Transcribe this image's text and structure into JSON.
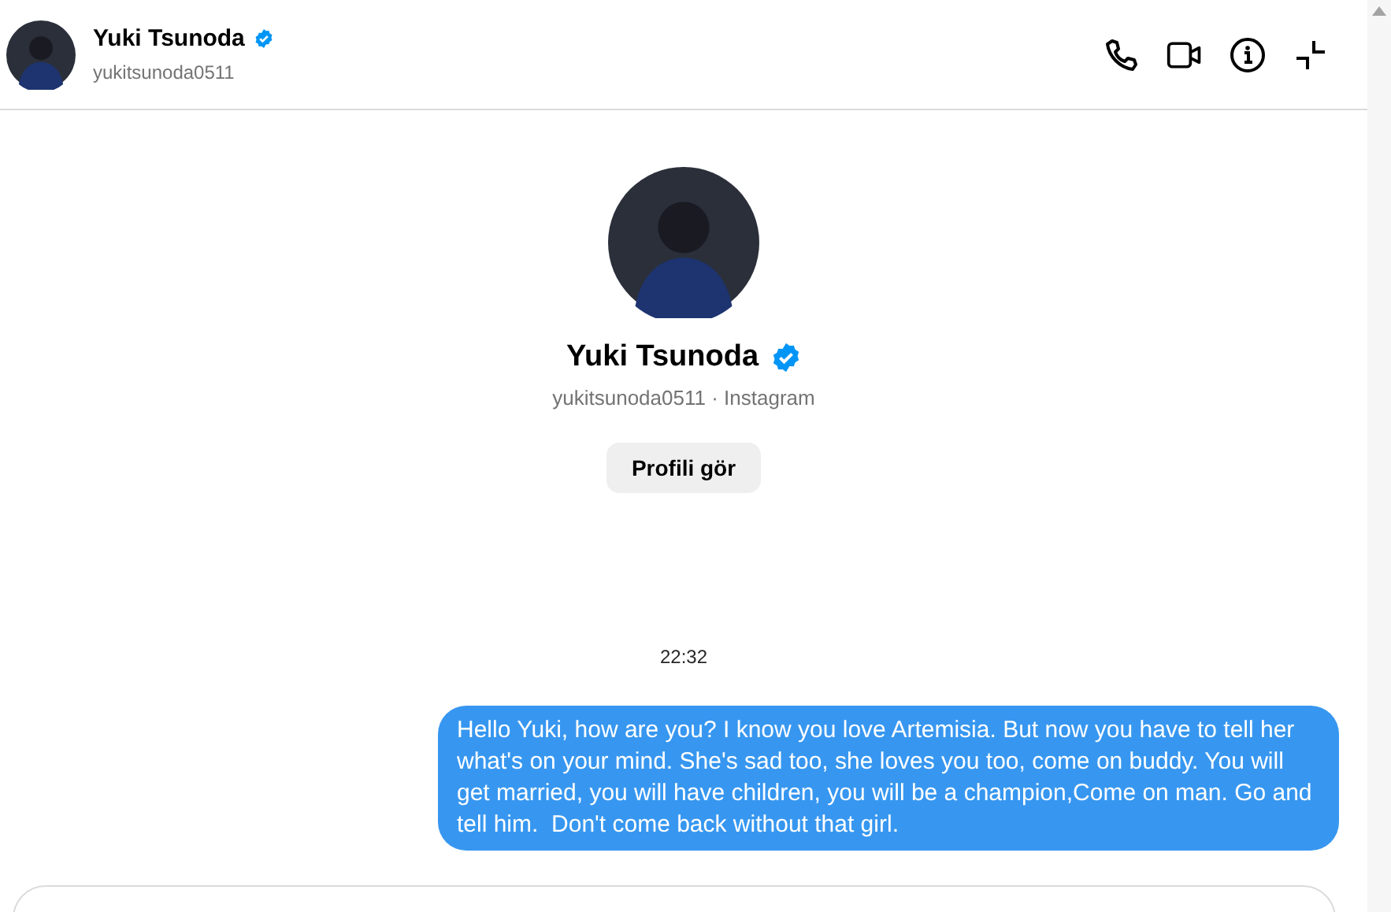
{
  "header": {
    "name": "Yuki Tsunoda",
    "verified": true,
    "username": "yukitsunoda0511"
  },
  "profile": {
    "name": "Yuki Tsunoda",
    "verified": true,
    "subtitle": "yukitsunoda0511 · Instagram",
    "button": "Profili gör"
  },
  "messages": [
    {
      "kind": "timestamp",
      "text": "22:32"
    },
    {
      "kind": "outgoing",
      "text": "Hello Yuki, how are you? I know you love Artemisia. But now you have to tell her what's on your mind. She's sad too, she loves you too, come on buddy. You will get married, you will have children, you will be a champion,Come on man. Go and tell him.  Don't come back without that girl."
    }
  ]
}
